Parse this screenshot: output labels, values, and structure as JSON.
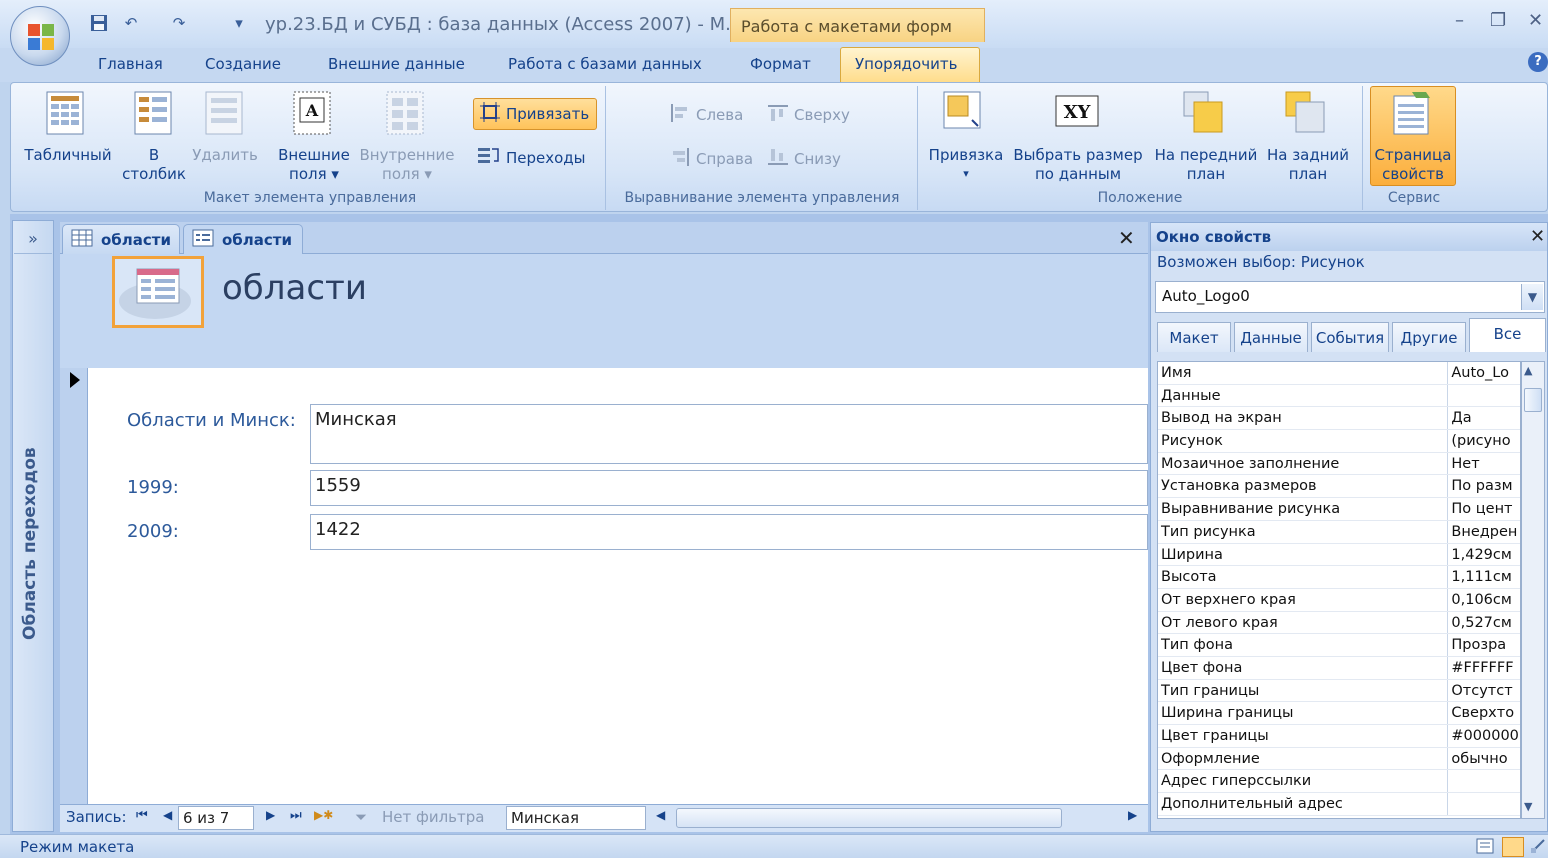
{
  "window": {
    "title": "ур.23.БД и СУБД : база данных (Access 2007) - М.",
    "context_tab_group": "Работа с макетами форм",
    "controls": {
      "minimize": "–",
      "restore": "❐",
      "close": "✕"
    }
  },
  "ribbon": {
    "tabs": [
      "Главная",
      "Создание",
      "Внешние данные",
      "Работа с базами данных",
      "Формат",
      "Упорядочить"
    ],
    "active_tab": "Упорядочить",
    "groups": {
      "layout": {
        "label": "Макет элемента управления",
        "tabular": "Табличный",
        "stacked_1": "В",
        "stacked_2": "столбик",
        "remove": "Удалить",
        "outer_1": "Внешние",
        "outer_2": "поля ▾",
        "inner_1": "Внутренние",
        "inner_2": "поля ▾",
        "snap": "Привязать",
        "tab_order": "Переходы"
      },
      "alignment": {
        "label": "Выравнивание элемента управления",
        "left": "Слева",
        "top": "Сверху",
        "right": "Справа",
        "bottom": "Снизу"
      },
      "position": {
        "label": "Положение",
        "anchor": "Привязка",
        "anchor_arrow": "▾",
        "size_fit_1": "Выбрать размер",
        "size_fit_2": "по данным",
        "front_1": "На передний",
        "front_2": "план",
        "back_1": "На задний",
        "back_2": "план"
      },
      "tools": {
        "label": "Сервис",
        "props_1": "Страница",
        "props_2": "свойств"
      }
    }
  },
  "nav_pane": {
    "toggle": "»",
    "title": "Область переходов"
  },
  "documents": {
    "tabs": [
      {
        "label": "области",
        "icon": "table-icon"
      },
      {
        "label": "области",
        "icon": "form-icon"
      }
    ],
    "close": "✕"
  },
  "form": {
    "title": "области",
    "fields": [
      {
        "label": "Области и Минск:",
        "value": "Минская"
      },
      {
        "label": "1999:",
        "value": "1559"
      },
      {
        "label": "2009:",
        "value": "1422"
      }
    ]
  },
  "record_nav": {
    "label": "Запись:",
    "first": "⏮",
    "prev": "◀",
    "current": "6 из 7",
    "next": "▶",
    "last": "⏭",
    "new": "▶✱",
    "filter": "Нет фильтра",
    "search": "Минская",
    "hscroll_left": "◀",
    "hscroll_right": "▶"
  },
  "property_sheet": {
    "title": "Окно свойств",
    "close": "✕",
    "selection_type": "Возможен выбор:  Рисунок",
    "object": "Auto_Logo0",
    "tabs": [
      "Макет",
      "Данные",
      "События",
      "Другие",
      "Все"
    ],
    "active_tab": "Все",
    "rows": [
      {
        "name": "Имя",
        "value": "Auto_Lo"
      },
      {
        "name": "Данные",
        "value": ""
      },
      {
        "name": "Вывод на экран",
        "value": "Да"
      },
      {
        "name": "Рисунок",
        "value": "(рисуно"
      },
      {
        "name": "Мозаичное заполнение",
        "value": "Нет"
      },
      {
        "name": "Установка размеров",
        "value": "По разм"
      },
      {
        "name": "Выравнивание рисунка",
        "value": "По цент"
      },
      {
        "name": "Тип рисунка",
        "value": "Внедрен"
      },
      {
        "name": "Ширина",
        "value": "1,429см"
      },
      {
        "name": "Высота",
        "value": "1,111см"
      },
      {
        "name": "От верхнего края",
        "value": "0,106см"
      },
      {
        "name": "От левого края",
        "value": "0,527см"
      },
      {
        "name": "Тип фона",
        "value": "Прозра"
      },
      {
        "name": "Цвет фона",
        "value": "#FFFFFF"
      },
      {
        "name": "Тип границы",
        "value": "Отсутст"
      },
      {
        "name": "Ширина границы",
        "value": "Сверхто"
      },
      {
        "name": "Цвет границы",
        "value": "#000000"
      },
      {
        "name": "Оформление",
        "value": "обычно"
      },
      {
        "name": "Адрес гиперссылки",
        "value": ""
      },
      {
        "name": "Дополнительный адрес",
        "value": ""
      }
    ]
  },
  "status": {
    "text": "Режим макета"
  },
  "colors": {
    "accent": "#15428b",
    "highlight": "#ffc35a",
    "background": "#bfd4ee"
  }
}
